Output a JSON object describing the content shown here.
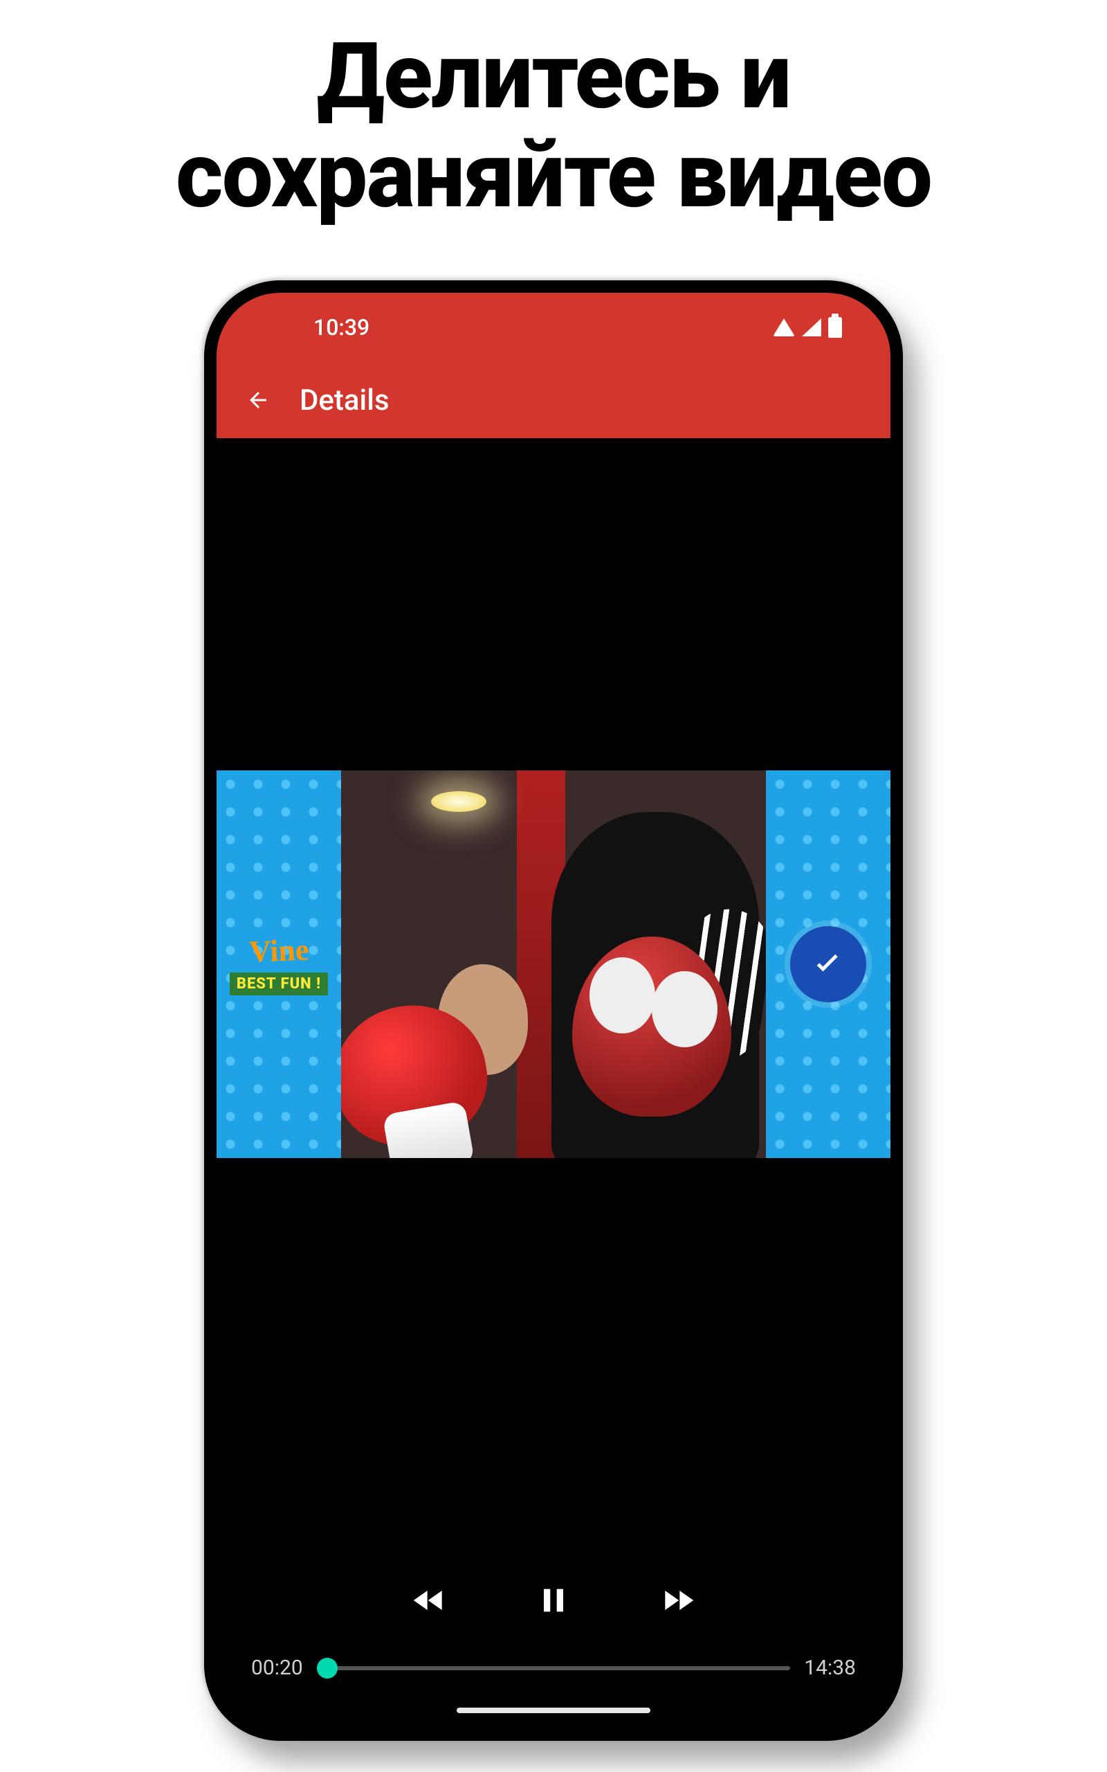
{
  "headline": {
    "line1": "Делитесь и",
    "line2": "сохраняйте видео"
  },
  "statusbar": {
    "time": "10:39"
  },
  "appbar": {
    "title": "Details"
  },
  "video": {
    "left_logo_script": "Vine",
    "left_logo_sub": "BEST FUN !"
  },
  "player": {
    "current_time": "00:20",
    "total_time": "14:38",
    "progress_percent": 2.3
  }
}
